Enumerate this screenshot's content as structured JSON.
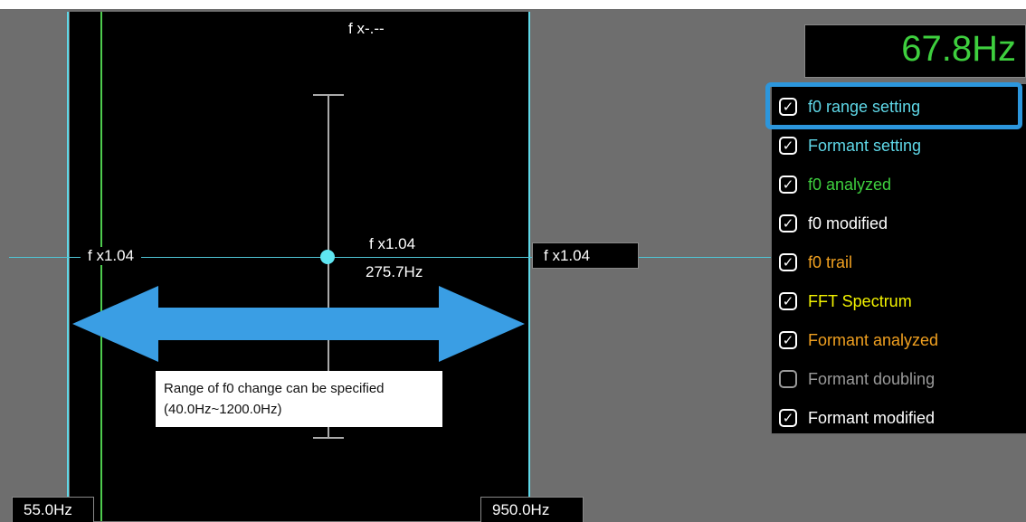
{
  "plot": {
    "top_label": "f x-.--",
    "left_scale": "f x1.04",
    "center_scale": "f x1.04",
    "center_freq": "275.7Hz",
    "right_scale": "f x1.04",
    "range_low": "55.0Hz",
    "range_high": "950.0Hz"
  },
  "annotation": {
    "line1": "Range of f0 change can be specified",
    "line2": "(40.0Hz~1200.0Hz)"
  },
  "readout": "67.8Hz",
  "panel": {
    "items": [
      {
        "label": "f0 range setting",
        "checked": "✓",
        "color": "#5fd8e8"
      },
      {
        "label": "Formant setting",
        "checked": "✓",
        "color": "#5fd8e8"
      },
      {
        "label": "f0 analyzed",
        "checked": "✓",
        "color": "#3ecf3e"
      },
      {
        "label": "f0 modified",
        "checked": "✓",
        "color": "#ffffff"
      },
      {
        "label": "f0 trail",
        "checked": "✓",
        "color": "#f0a020"
      },
      {
        "label": "FFT Spectrum",
        "checked": "✓",
        "color": "#f2f200"
      },
      {
        "label": "Formant analyzed",
        "checked": "✓",
        "color": "#f0a020"
      },
      {
        "label": "Formant doubling",
        "checked": "",
        "color": "#9a9a9a"
      },
      {
        "label": "Formant modified",
        "checked": "✓",
        "color": "#ffffff"
      }
    ]
  }
}
